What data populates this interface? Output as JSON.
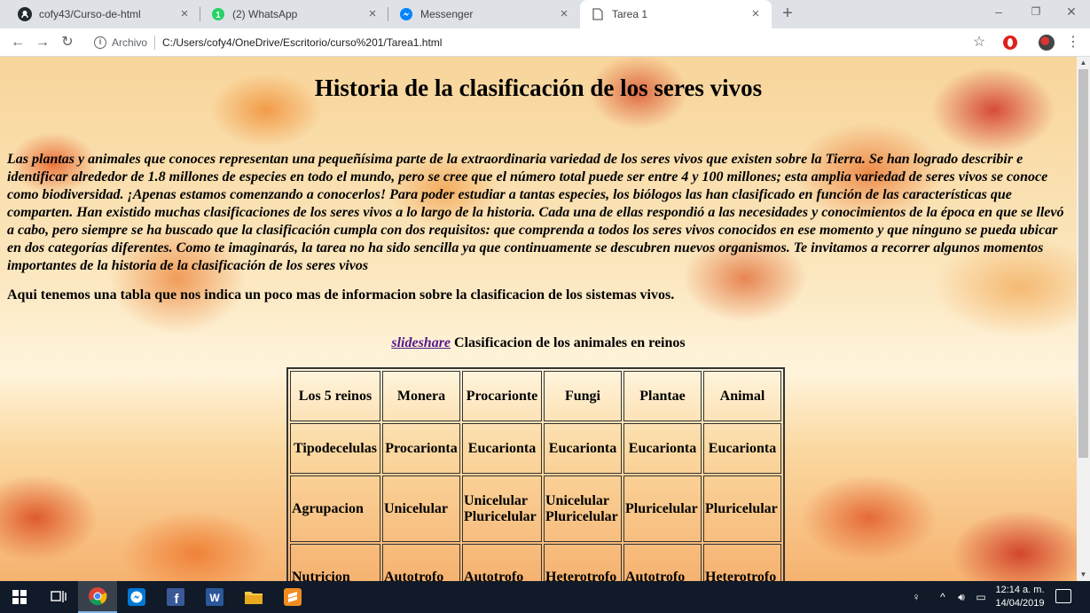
{
  "browser": {
    "tabs": [
      {
        "title": "cofy43/Curso-de-html",
        "icon": "github-icon"
      },
      {
        "title": "(2) WhatsApp",
        "icon": "whatsapp-icon"
      },
      {
        "title": "Messenger",
        "icon": "messenger-icon"
      },
      {
        "title": "Tarea 1",
        "icon": "page-icon"
      }
    ],
    "address": {
      "scheme_label": "Archivo",
      "url": "C:/Users/cofy4/OneDrive/Escritorio/curso%201/Tarea1.html"
    }
  },
  "page": {
    "heading": "Historia de la clasificación de los seres vivos",
    "intro": "Las plantas y animales que conoces representan una pequeñísima parte de la extraordinaria variedad de los seres vivos que existen sobre la Tierra. Se han logrado describir e identificar alrededor de 1.8 millones de especies en todo el mundo, pero se cree que el número total puede ser entre 4 y 100 millones; esta amplia variedad de seres vivos se conoce como biodiversidad. ¡Apenas estamos comenzando a conocerlos! Para poder estudiar a tantas especies, los biólogos las han clasificado en función de las características que comparten. Han existido muchas clasificaciones de los seres vivos a lo largo de la historia. Cada una de ellas respondió a las necesidades y conocimientos de la época en que se llevó a cabo, pero siempre se ha buscado que la clasificación cumpla con dos requisitos: que comprenda a todos los seres vivos conocidos en ese momento y que ninguno se pueda ubicar en dos categorías diferentes. Como te imaginarás, la tarea no ha sido sencilla ya que continuamente se descubren nuevos organismos. Te invitamos a recorrer algunos momentos importantes de la historia de la clasificación de los seres vivos",
    "subtitle": "Aqui tenemos una tabla que nos indica un poco mas de informacion sobre la clasificacion de los sistemas vivos.",
    "caption_link": "slideshare",
    "caption_text": " Clasificacion de los animales en reinos",
    "table": [
      [
        "Los 5 reinos",
        "Monera",
        "Procarionte",
        "Fungi",
        "Plantae",
        "Animal"
      ],
      [
        "Tipodecelulas",
        "Procarionta",
        "Eucarionta",
        "Eucarionta",
        "Eucarionta",
        "Eucarionta"
      ],
      [
        "Agrupacion",
        "Unicelular",
        "Unicelular Pluricelular",
        "Unicelular Pluricelular",
        "Pluricelular",
        "Pluricelular"
      ],
      [
        "Nutricion",
        "Autotrofo",
        "Autotrofo",
        "Heterotrofo",
        "Autotrofo",
        "Heterotrofo"
      ]
    ]
  },
  "taskbar": {
    "apps": [
      "windows-start-icon",
      "task-view-icon",
      "chrome-icon",
      "messenger-icon",
      "facebook-icon",
      "word-icon",
      "file-explorer-icon",
      "sublime-text-icon"
    ],
    "clock_time": "12:14 a. m.",
    "clock_date": "14/04/2019"
  }
}
